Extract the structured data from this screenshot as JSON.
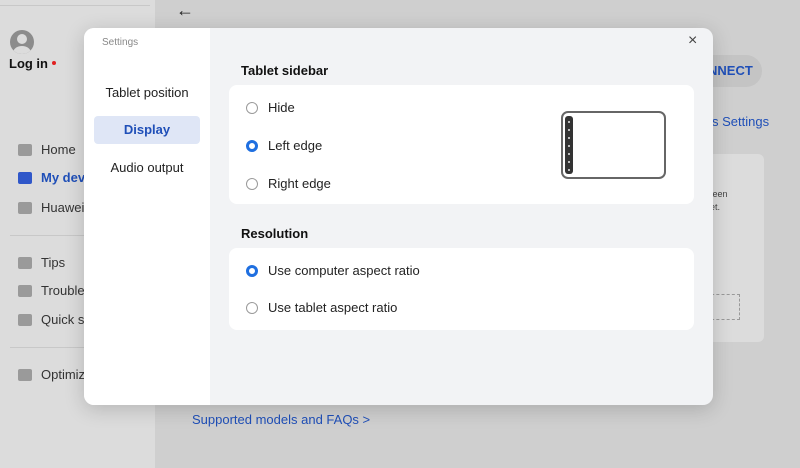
{
  "background": {
    "login": {
      "label": "Log in"
    },
    "nav": [
      {
        "label": "Home",
        "icon": "home-icon"
      },
      {
        "label": "My devi",
        "icon": "device-icon"
      },
      {
        "label": "Huawei",
        "icon": "share-icon"
      },
      {
        "label": "Tips",
        "icon": "tips-icon"
      },
      {
        "label": "Troubles",
        "icon": "wrench-icon"
      },
      {
        "label": "Quick se",
        "icon": "shield-icon"
      },
      {
        "label": "Optimiz",
        "icon": "optimize-icon"
      }
    ],
    "back_icon": "←",
    "connect_label": "NNECT",
    "settings_link": "s Settings",
    "card_text": "veen\nlet.",
    "bottom_link": "Supported models and FAQs >"
  },
  "modal": {
    "title": "Settings",
    "close_icon": "×",
    "menu": [
      {
        "label": "Tablet position",
        "selected": false
      },
      {
        "label": "Display",
        "selected": true
      },
      {
        "label": "Audio output",
        "selected": false
      }
    ],
    "sidebar_section": {
      "title": "Tablet sidebar",
      "options": [
        {
          "label": "Hide",
          "checked": false
        },
        {
          "label": "Left edge",
          "checked": true
        },
        {
          "label": "Right edge",
          "checked": false
        }
      ]
    },
    "resolution_section": {
      "title": "Resolution",
      "options": [
        {
          "label": "Use computer aspect ratio",
          "checked": true
        },
        {
          "label": "Use tablet aspect ratio",
          "checked": false
        }
      ]
    }
  },
  "colors": {
    "accent": "#1f6fe0",
    "link": "#1f4fb8",
    "selected_bg": "#dfe6f6"
  }
}
